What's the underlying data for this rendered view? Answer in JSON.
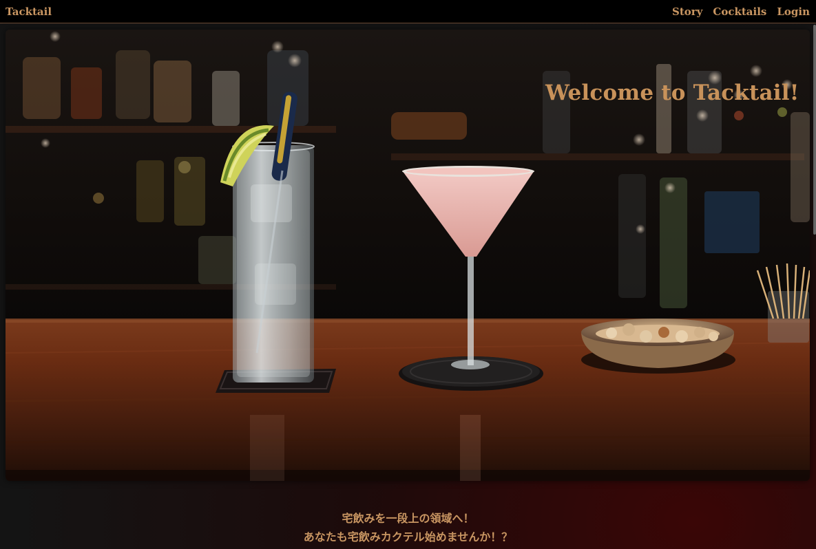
{
  "header": {
    "brand": "Tacktail",
    "nav": [
      {
        "label": "Story"
      },
      {
        "label": "Cocktails"
      },
      {
        "label": "Login"
      }
    ]
  },
  "hero": {
    "title": "Welcome to Tacktail!"
  },
  "intro": {
    "line1": "宅飲みを一段上の領域へ！",
    "line2": "あなたも宅飲みカクテル始めませんか！？"
  },
  "colors": {
    "accent": "#c99662",
    "topbar": "#000000",
    "background": "#161616"
  }
}
